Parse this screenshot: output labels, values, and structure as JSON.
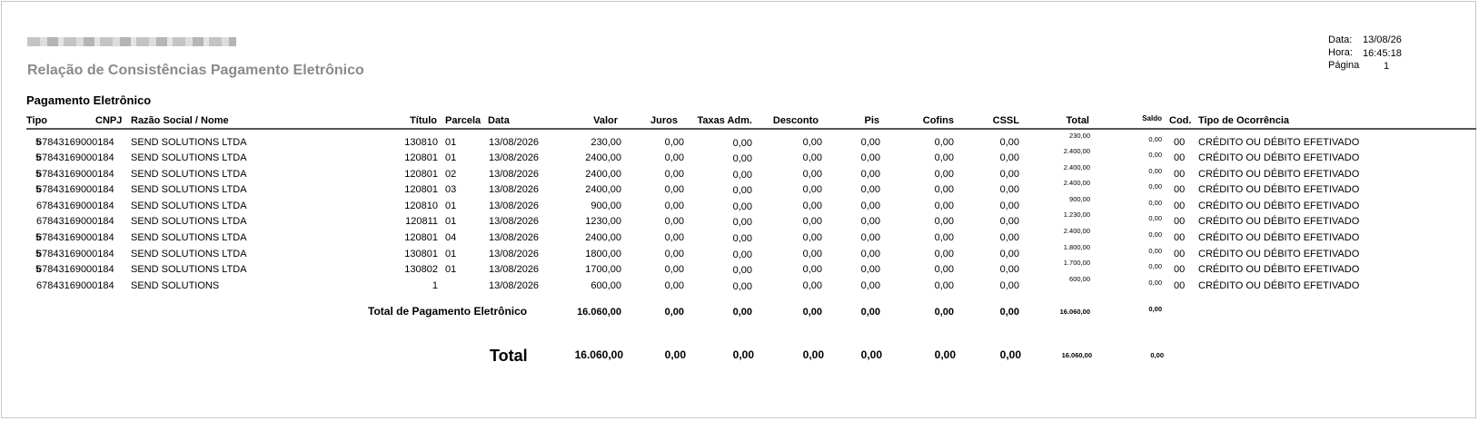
{
  "header": {
    "report_title": "Relação de Consistências Pagamento Eletrônico",
    "date_label": "Data:",
    "date_value": "13/08/26",
    "time_label": "Hora:",
    "time_value": "16:45:18",
    "page_label": "Página",
    "page_value": "1"
  },
  "section": {
    "title": "Pagamento Eletrônico"
  },
  "columns": {
    "tipo": "Tipo",
    "cnpj": "CNPJ",
    "razao": "Razão Social / Nome",
    "titulo": "Título",
    "parcela": "Parcela",
    "data": "Data",
    "valor": "Valor",
    "juros": "Juros",
    "taxas": "Taxas Adm.",
    "desconto": "Desconto",
    "pis": "Pis",
    "cofins": "Cofins",
    "cssl": "CSSL",
    "total": "Total",
    "saldo": "Saldo",
    "cod": "Cod.",
    "ocorrencia": "Tipo de Ocorrência"
  },
  "rows": [
    {
      "tipo": "5",
      "cnpj": "67843169000184",
      "razao": "SEND SOLUTIONS LTDA",
      "titulo": "130810",
      "parcela": "01",
      "data": "13/08/2026",
      "valor": "230,00",
      "juros": "0,00",
      "taxas": "0,00",
      "desconto": "0,00",
      "pis": "0,00",
      "cofins": "0,00",
      "cssl": "0,00",
      "total": "230,00",
      "saldo": "0,00",
      "cod": "00",
      "ocorrencia": "CRÉDITO OU DÉBITO EFETIVADO"
    },
    {
      "tipo": "5",
      "cnpj": "67843169000184",
      "razao": "SEND SOLUTIONS LTDA",
      "titulo": "120801",
      "parcela": "01",
      "data": "13/08/2026",
      "valor": "2400,00",
      "juros": "0,00",
      "taxas": "0,00",
      "desconto": "0,00",
      "pis": "0,00",
      "cofins": "0,00",
      "cssl": "0,00",
      "total": "2.400,00",
      "saldo": "0,00",
      "cod": "00",
      "ocorrencia": "CRÉDITO OU DÉBITO EFETIVADO"
    },
    {
      "tipo": "5",
      "cnpj": "67843169000184",
      "razao": "SEND SOLUTIONS LTDA",
      "titulo": "120801",
      "parcela": "02",
      "data": "13/08/2026",
      "valor": "2400,00",
      "juros": "0,00",
      "taxas": "0,00",
      "desconto": "0,00",
      "pis": "0,00",
      "cofins": "0,00",
      "cssl": "0,00",
      "total": "2.400,00",
      "saldo": "0,00",
      "cod": "00",
      "ocorrencia": "CRÉDITO OU DÉBITO EFETIVADO"
    },
    {
      "tipo": "5",
      "cnpj": "67843169000184",
      "razao": "SEND SOLUTIONS LTDA",
      "titulo": "120801",
      "parcela": "03",
      "data": "13/08/2026",
      "valor": "2400,00",
      "juros": "0,00",
      "taxas": "0,00",
      "desconto": "0,00",
      "pis": "0,00",
      "cofins": "0,00",
      "cssl": "0,00",
      "total": "2.400,00",
      "saldo": "0,00",
      "cod": "00",
      "ocorrencia": "CRÉDITO OU DÉBITO EFETIVADO"
    },
    {
      "tipo": "",
      "cnpj": "67843169000184",
      "razao": "SEND SOLUTIONS LTDA",
      "titulo": "120810",
      "parcela": "01",
      "data": "13/08/2026",
      "valor": "900,00",
      "juros": "0,00",
      "taxas": "0,00",
      "desconto": "0,00",
      "pis": "0,00",
      "cofins": "0,00",
      "cssl": "0,00",
      "total": "900,00",
      "saldo": "0,00",
      "cod": "00",
      "ocorrencia": "CRÉDITO OU DÉBITO EFETIVADO"
    },
    {
      "tipo": "",
      "cnpj": "67843169000184",
      "razao": "SEND SOLUTIONS LTDA",
      "titulo": "120811",
      "parcela": "01",
      "data": "13/08/2026",
      "valor": "1230,00",
      "juros": "0,00",
      "taxas": "0,00",
      "desconto": "0,00",
      "pis": "0,00",
      "cofins": "0,00",
      "cssl": "0,00",
      "total": "1.230,00",
      "saldo": "0,00",
      "cod": "00",
      "ocorrencia": "CRÉDITO OU DÉBITO EFETIVADO"
    },
    {
      "tipo": "5",
      "cnpj": "67843169000184",
      "razao": "SEND SOLUTIONS LTDA",
      "titulo": "120801",
      "parcela": "04",
      "data": "13/08/2026",
      "valor": "2400,00",
      "juros": "0,00",
      "taxas": "0,00",
      "desconto": "0,00",
      "pis": "0,00",
      "cofins": "0,00",
      "cssl": "0,00",
      "total": "2.400,00",
      "saldo": "0,00",
      "cod": "00",
      "ocorrencia": "CRÉDITO OU DÉBITO EFETIVADO"
    },
    {
      "tipo": "5",
      "cnpj": "67843169000184",
      "razao": "SEND SOLUTIONS LTDA",
      "titulo": "130801",
      "parcela": "01",
      "data": "13/08/2026",
      "valor": "1800,00",
      "juros": "0,00",
      "taxas": "0,00",
      "desconto": "0,00",
      "pis": "0,00",
      "cofins": "0,00",
      "cssl": "0,00",
      "total": "1.800,00",
      "saldo": "0,00",
      "cod": "00",
      "ocorrencia": "CRÉDITO OU DÉBITO EFETIVADO"
    },
    {
      "tipo": "5",
      "cnpj": "67843169000184",
      "razao": "SEND SOLUTIONS LTDA",
      "titulo": "130802",
      "parcela": "01",
      "data": "13/08/2026",
      "valor": "1700,00",
      "juros": "0,00",
      "taxas": "0,00",
      "desconto": "0,00",
      "pis": "0,00",
      "cofins": "0,00",
      "cssl": "0,00",
      "total": "1.700,00",
      "saldo": "0,00",
      "cod": "00",
      "ocorrencia": "CRÉDITO OU DÉBITO EFETIVADO"
    },
    {
      "tipo": "",
      "cnpj": "67843169000184",
      "razao": "SEND SOLUTIONS",
      "titulo": "1",
      "parcela": "",
      "data": "13/08/2026",
      "valor": "600,00",
      "juros": "0,00",
      "taxas": "0,00",
      "desconto": "0,00",
      "pis": "0,00",
      "cofins": "0,00",
      "cssl": "0,00",
      "total": "600,00",
      "saldo": "0,00",
      "cod": "00",
      "ocorrencia": "CRÉDITO OU DÉBITO EFETIVADO"
    }
  ],
  "section_total": {
    "label": "Total de Pagamento Eletrônico",
    "valor": "16.060,00",
    "juros": "0,00",
    "taxas": "0,00",
    "desconto": "0,00",
    "pis": "0,00",
    "cofins": "0,00",
    "cssl": "0,00",
    "total": "16.060,00",
    "saldo": "0,00"
  },
  "grand_total": {
    "label": "Total",
    "valor": "16.060,00",
    "juros": "0,00",
    "taxas": "0,00",
    "desconto": "0,00",
    "pis": "0,00",
    "cofins": "0,00",
    "cssl": "0,00",
    "total": "16.060,00",
    "saldo": "0,00"
  }
}
